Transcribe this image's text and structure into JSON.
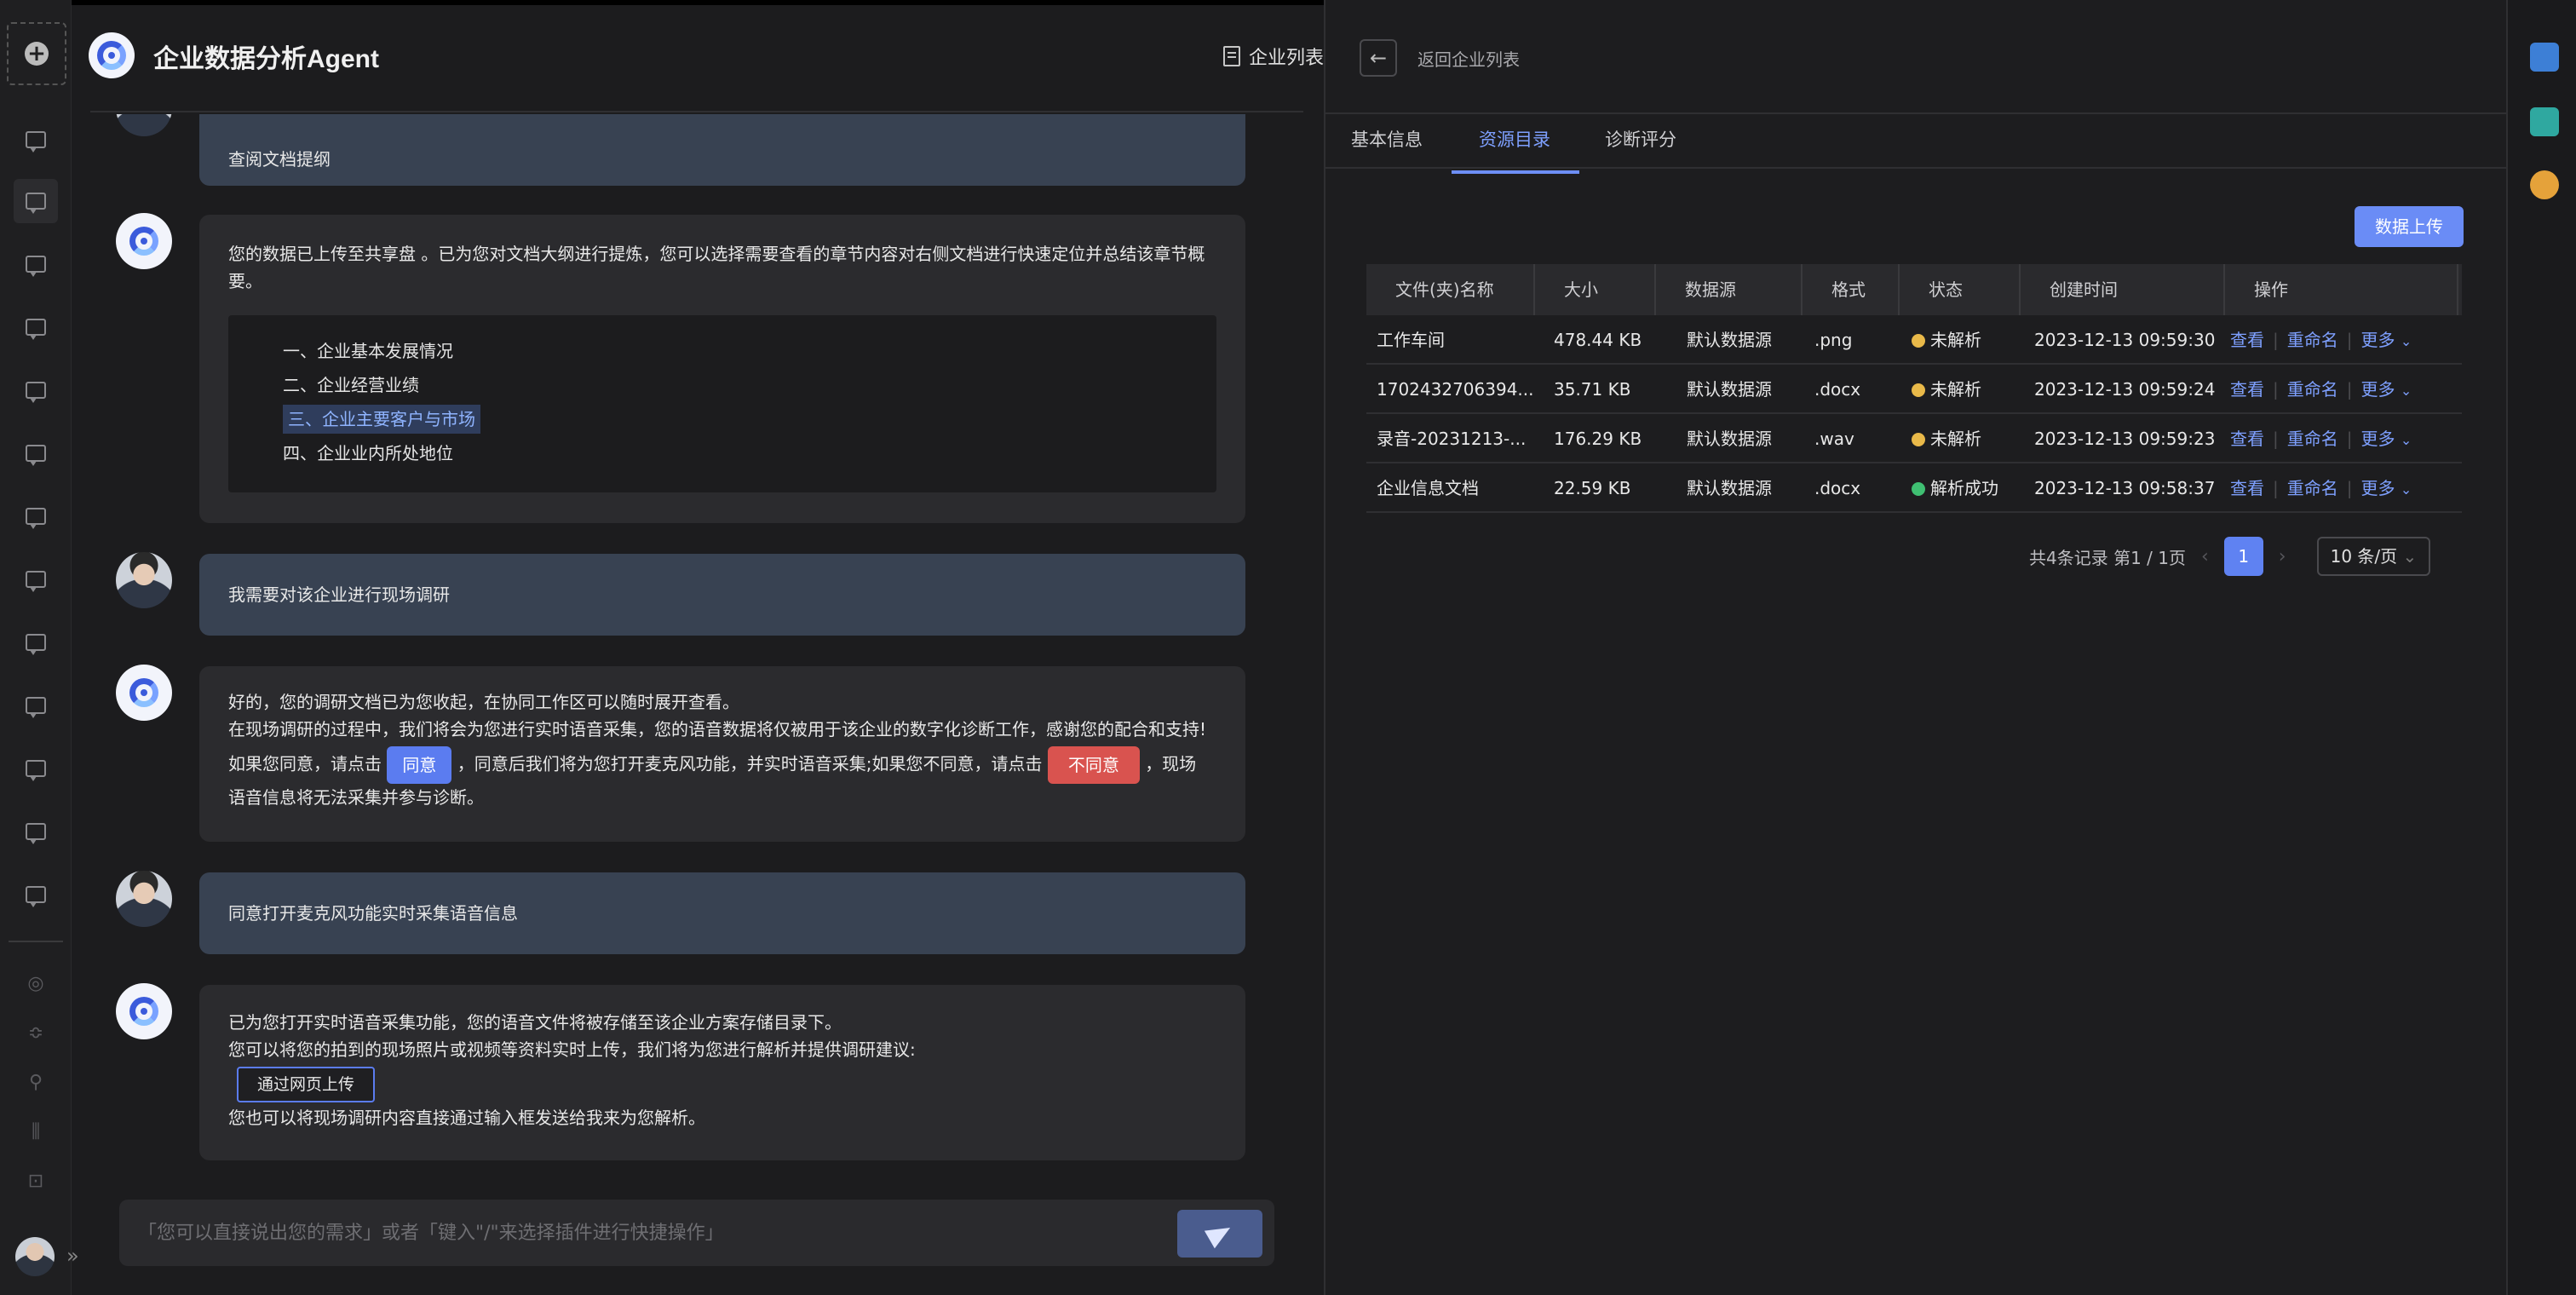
{
  "app": {
    "title": "企业数据分析Agent",
    "company_list": "企业列表"
  },
  "chat": {
    "top_partial": "查阅文档提纲",
    "msg1": {
      "text": "您的数据已上传至共享盘 。已为您对文档大纲进行提炼，您可以选择需要查看的章节内容对右侧文档进行快速定位并总结该章节概要。",
      "outline": [
        "一、企业基本发展情况",
        "二、企业经营业绩",
        "三、企业主要客户与市场",
        "四、企业业内所处地位"
      ]
    },
    "msg2": "我需要对该企业进行现场调研",
    "msg3": {
      "line1": "好的，您的调研文档已为您收起，在协同工作区可以随时展开查看。",
      "line2": "在现场调研的过程中，我们将会为您进行实时语音采集，您的语音数据将仅被用于该企业的数字化诊断工作，感谢您的配合和支持!",
      "line3_a": "如果您同意，请点击",
      "agree": "同意",
      "line3_b": "，同意后我们将为您打开麦克风功能，并实时语音采集;如果您不同意，请点击",
      "disagree": "不同意",
      "line3_c": "，现场",
      "line4": "语音信息将无法采集并参与诊断。"
    },
    "msg4": "同意打开麦克风功能实时采集语音信息",
    "msg5": {
      "line1": "已为您打开实时语音采集功能，您的语音文件将被存储至该企业方案存储目录下。",
      "line2": "您可以将您的拍到的现场照片或视频等资料实时上传，我们将为您进行解析并提供调研建议:",
      "upload": "通过网页上传",
      "line3": "您也可以将现场调研内容直接通过输入框发送给我来为您解析。"
    },
    "input_placeholder": "「您可以直接说出您的需求」或者「键入\"/\"来选择插件进行快捷操作」"
  },
  "panel": {
    "back": "返回企业列表",
    "tabs": [
      "基本信息",
      "资源目录",
      "诊断评分"
    ],
    "upload_button": "数据上传",
    "columns": [
      "文件(夹)名称",
      "大小",
      "数据源",
      "格式",
      "状态",
      "创建时间",
      "操作"
    ],
    "rows": [
      {
        "name": "工作车间",
        "size": "478.44 KB",
        "source": "默认数据源",
        "format": ".png",
        "status": "未解析",
        "status_color": "#e9b949",
        "created": "2023-12-13 09:59:30"
      },
      {
        "name": "1702432706394...",
        "size": "35.71 KB",
        "source": "默认数据源",
        "format": ".docx",
        "status": "未解析",
        "status_color": "#e9b949",
        "created": "2023-12-13 09:59:24"
      },
      {
        "name": "录音-20231213-...",
        "size": "176.29 KB",
        "source": "默认数据源",
        "format": ".wav",
        "status": "未解析",
        "status_color": "#e9b949",
        "created": "2023-12-13 09:59:23"
      },
      {
        "name": "企业信息文档",
        "size": "22.59 KB",
        "source": "默认数据源",
        "format": ".docx",
        "status": "解析成功",
        "status_color": "#3fbf72",
        "created": "2023-12-13 09:58:37"
      }
    ],
    "ops": {
      "view": "查看",
      "rename": "重命名",
      "more": "更多"
    },
    "pager": {
      "summary": "共4条记录 第1 / 1页",
      "page": "1",
      "page_size": "10 条/页"
    }
  }
}
